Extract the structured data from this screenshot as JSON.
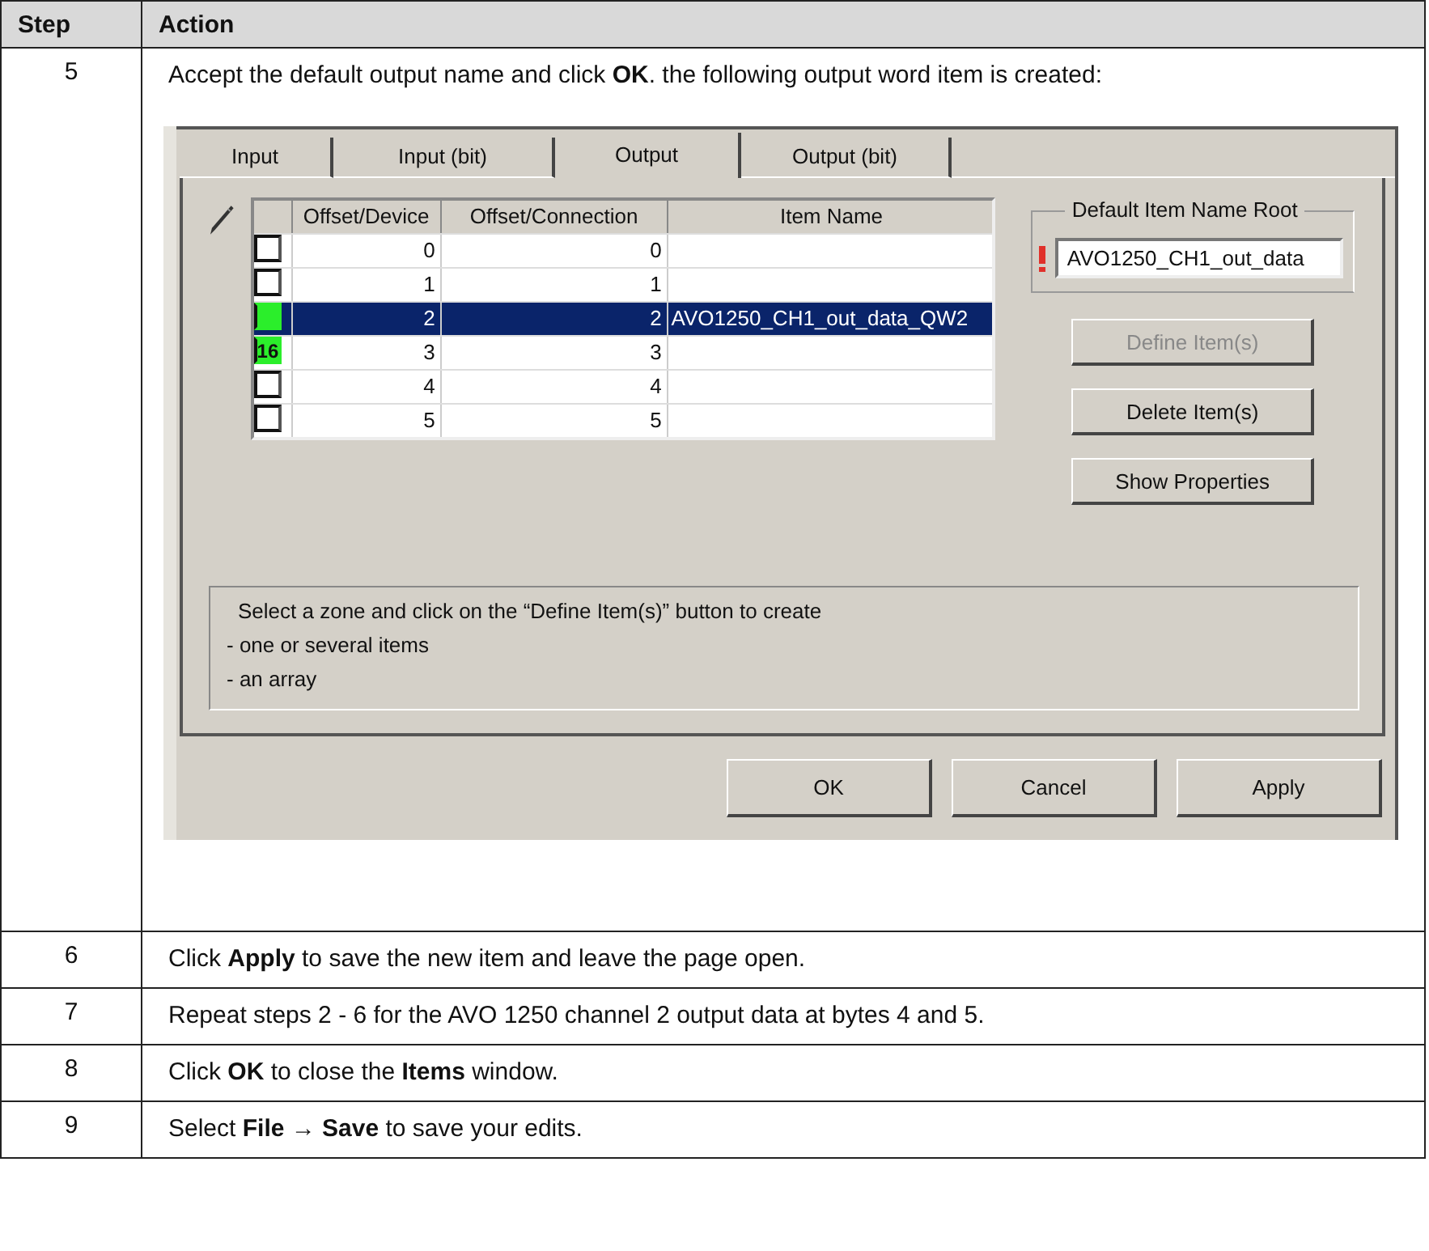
{
  "table": {
    "columns": [
      "Step",
      "Action"
    ],
    "rows": [
      {
        "step": "5",
        "text": "Accept the default output name and click **OK**. the following output word item is created:",
        "dialog": {
          "tabs": [
            {
              "label": "Input",
              "selected": false
            },
            {
              "label": "Input (bit)",
              "selected": false
            },
            {
              "label": "Output",
              "selected": true
            },
            {
              "label": "Output (bit)",
              "selected": false
            }
          ],
          "grid": {
            "columns": [
              "Offset/Device",
              "Offset/Connection",
              "Item Name"
            ],
            "rows": [
              {
                "in_item": false,
                "selected": false,
                "device": "0",
                "connection": "0",
                "name": ""
              },
              {
                "in_item": false,
                "selected": false,
                "device": "1",
                "connection": "1",
                "name": ""
              },
              {
                "in_item": true,
                "selected": true,
                "device": "2",
                "connection": "2",
                "name": "AVO1250_CH1_out_data_QW2"
              },
              {
                "in_item": true,
                "selected": false,
                "marker": "16",
                "device": "3",
                "connection": "3",
                "name": ""
              },
              {
                "in_item": false,
                "selected": false,
                "device": "4",
                "connection": "4",
                "name": ""
              },
              {
                "in_item": false,
                "selected": false,
                "device": "5",
                "connection": "5",
                "name": ""
              }
            ]
          },
          "name_root": {
            "title": "Default Item Name Root",
            "value": "AVO1250_CH1_out_data",
            "warning": true
          },
          "side_buttons": [
            {
              "label": "Define Item(s)",
              "disabled": true
            },
            {
              "label": "Delete Item(s)",
              "disabled": false
            },
            {
              "label": "Show Properties",
              "disabled": false
            }
          ],
          "info": [
            "Select a zone and click on the “Define Item(s)” button to create",
            "- one or several items",
            "- an array"
          ],
          "buttons": [
            "OK",
            "Cancel",
            "Apply"
          ]
        }
      },
      {
        "step": "6",
        "text": "Click **Apply** to save the new item and leave the page open."
      },
      {
        "step": "7",
        "text": "Repeat steps 2 - 6 for the AVO 1250 channel 2 output data at bytes 4 and 5."
      },
      {
        "step": "8",
        "text": "Click **OK** to close the **Items** window."
      },
      {
        "step": "9",
        "text": "Select **File → Save** to save your edits."
      }
    ]
  }
}
